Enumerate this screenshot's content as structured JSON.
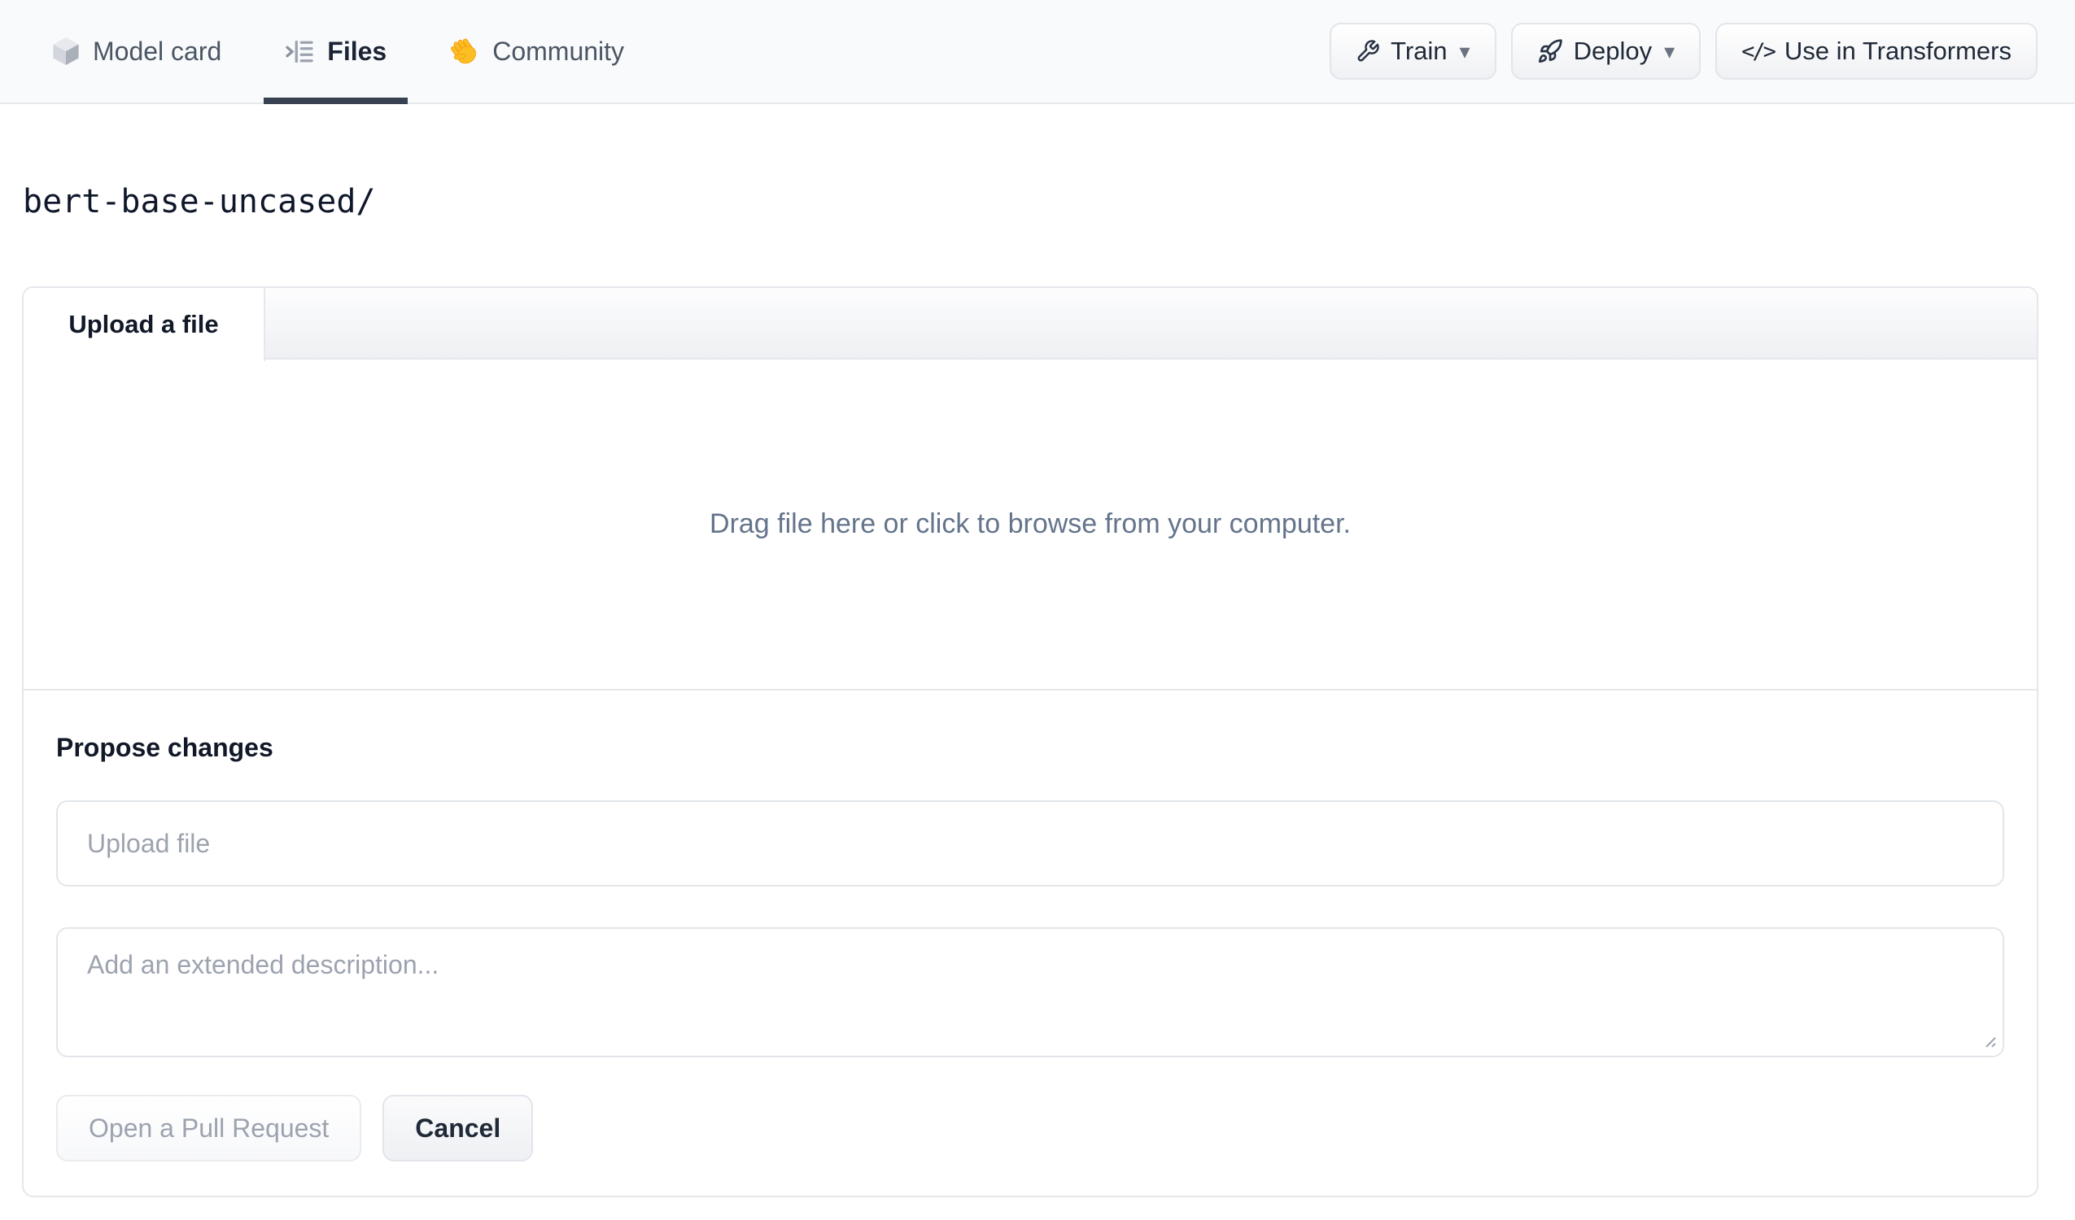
{
  "nav": {
    "tabs": [
      {
        "label": "Model card",
        "icon": "cube-icon",
        "active": false
      },
      {
        "label": "Files",
        "icon": "files-list-icon",
        "active": true
      },
      {
        "label": "Community",
        "icon": "waving-hand-icon",
        "active": false
      }
    ],
    "actions": [
      {
        "label": "Train",
        "icon": "wrench-icon",
        "caret": "▾"
      },
      {
        "label": "Deploy",
        "icon": "rocket-icon",
        "caret": "▾"
      },
      {
        "label": "Use in Transformers",
        "icon": "code-icon",
        "code_glyph": "</>"
      }
    ]
  },
  "breadcrumb": {
    "repo_path": "bert-base-uncased/"
  },
  "upload_card": {
    "tab_label": "Upload a file",
    "dropzone_text": "Drag file here or click to browse from your computer.",
    "propose": {
      "heading": "Propose changes",
      "filename_placeholder": "Upload file",
      "description_placeholder": "Add an extended description...",
      "submit_label": "Open a Pull Request",
      "cancel_label": "Cancel"
    }
  },
  "colors": {
    "nav_background": "#f8fafc",
    "border": "#e5e7eb",
    "active_tab_underline": "#374151",
    "text_dark": "#111827",
    "text_inactive_tab": "#4b5563",
    "dropzone_text": "#64748b",
    "placeholder": "#9ca3af",
    "disabled_button_text": "#9ca3af",
    "hand_emoji_yellow": "#fbbf24",
    "cube_faces": [
      "#e7e9ed",
      "#d3d7dd",
      "#aab0ba"
    ]
  }
}
